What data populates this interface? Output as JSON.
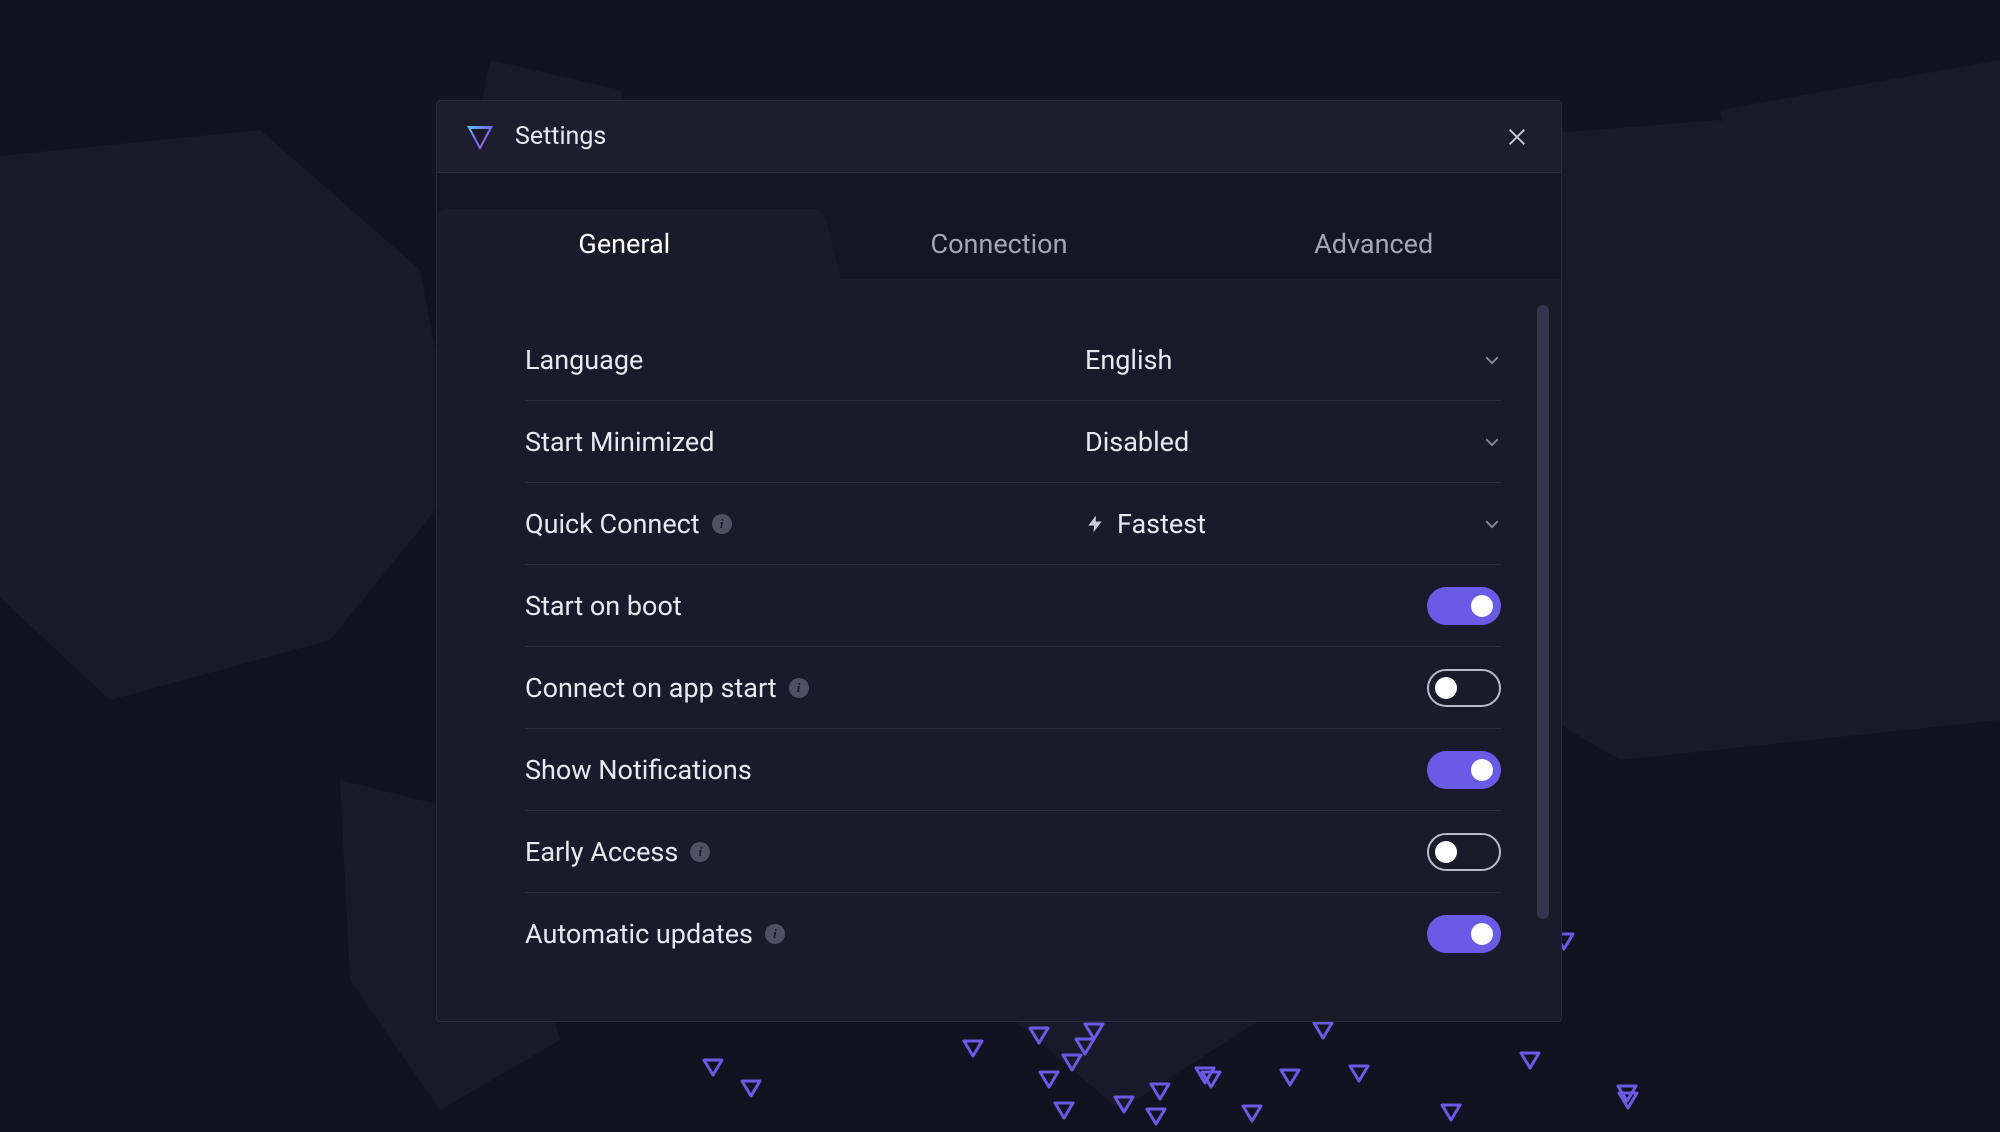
{
  "dialog": {
    "title": "Settings"
  },
  "tabs": {
    "general": "General",
    "connection": "Connection",
    "advanced": "Advanced"
  },
  "settings": {
    "language": {
      "label": "Language",
      "value": "English"
    },
    "start_minimized": {
      "label": "Start Minimized",
      "value": "Disabled"
    },
    "quick_connect": {
      "label": "Quick Connect",
      "value": "Fastest"
    },
    "start_on_boot": {
      "label": "Start on boot",
      "on": true
    },
    "connect_on_start": {
      "label": "Connect on app start",
      "on": false
    },
    "show_notifications": {
      "label": "Show Notifications",
      "on": true
    },
    "early_access": {
      "label": "Early Access",
      "on": false
    },
    "auto_updates": {
      "label": "Automatic updates",
      "on": true
    }
  },
  "colors": {
    "accent": "#6a5ae5"
  }
}
